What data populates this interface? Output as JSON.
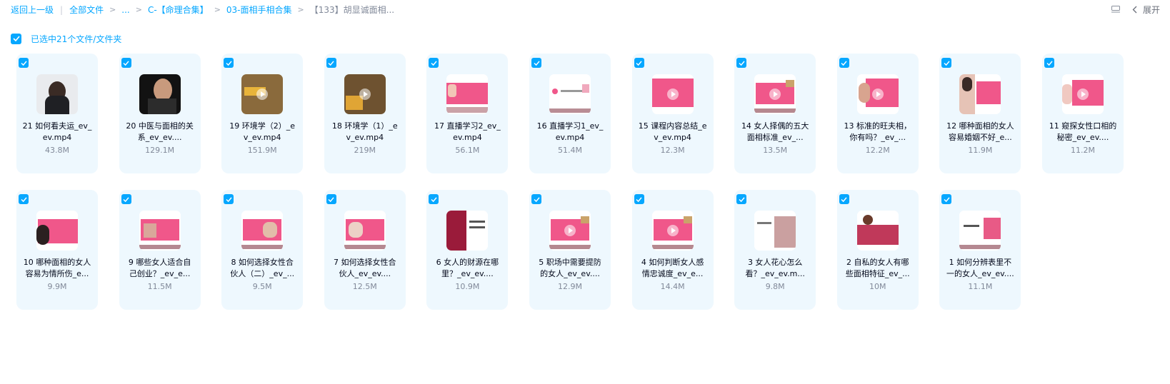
{
  "breadcrumb": {
    "back_label": "返回上一级",
    "items": [
      {
        "label": "全部文件"
      },
      {
        "label": "..."
      },
      {
        "label": "C-【命理合集】"
      },
      {
        "label": "03-面相手相合集"
      },
      {
        "label": "【133】胡显诚面相..."
      }
    ]
  },
  "toolbar": {
    "expand_label": "展开",
    "list_icon": "list-view-icon",
    "chevron_icon": "chevron-left-icon"
  },
  "selection": {
    "text": "已选中21个文件/文件夹"
  },
  "colors": {
    "accent": "#06a7ff",
    "card_bg": "#eef8fe",
    "pink": "#f0578a"
  },
  "files": [
    {
      "name": "21 如何看夫运_ev_ev.mp4",
      "size": "43.8M",
      "thumb": "person"
    },
    {
      "name": "20 中医与面相的关系_ev_ev....",
      "size": "129.1M",
      "thumb": "person-dark"
    },
    {
      "name": "19 环境学（2）_ev_ev.mp4",
      "size": "151.9M",
      "thumb": "brown"
    },
    {
      "name": "18 环境学（1）_ev_ev.mp4",
      "size": "219M",
      "thumb": "brown2"
    },
    {
      "name": "17 直播学习2_ev_ev.mp4",
      "size": "56.1M",
      "thumb": "slide-photo"
    },
    {
      "name": "16 直播学习1_ev_ev.mp4",
      "size": "51.4M",
      "thumb": "slide-white"
    },
    {
      "name": "15 课程内容总结_ev_ev.mp4",
      "size": "12.3M",
      "thumb": "slide-pink"
    },
    {
      "name": "14 女人择偶的五大面相标准_ev_...",
      "size": "13.5M",
      "thumb": "slide-pink-play"
    },
    {
      "name": "13 标准的旺夫相，你有吗？_ev_...",
      "size": "12.2M",
      "thumb": "slide-face"
    },
    {
      "name": "12 哪种面相的女人容易婚姻不好_e...",
      "size": "11.9M",
      "thumb": "slide-face2"
    },
    {
      "name": "11 窥探女性口相的秘密_ev_ev....",
      "size": "11.2M",
      "thumb": "slide-face3"
    },
    {
      "name": "10 哪种面相的女人容易为情所伤_e...",
      "size": "9.9M",
      "thumb": "slide-face4"
    },
    {
      "name": "9 哪些女人适合自己创业？_ev_e...",
      "size": "11.5M",
      "thumb": "slide-photo2"
    },
    {
      "name": "8 如何选择女性合伙人（二）_ev_...",
      "size": "9.5M",
      "thumb": "slide-photo3"
    },
    {
      "name": "7 如何选择女性合伙人_ev_ev....",
      "size": "12.5M",
      "thumb": "slide-photo4"
    },
    {
      "name": "6 女人的财源在哪里？_ev_ev....",
      "size": "10.9M",
      "thumb": "slide-red"
    },
    {
      "name": "5 职场中需要提防的女人_ev_ev....",
      "size": "12.9M",
      "thumb": "slide-pink-play"
    },
    {
      "name": "4 如何判断女人感情忠诚度_ev_e...",
      "size": "14.4M",
      "thumb": "slide-pink-play"
    },
    {
      "name": "3 女人花心怎么看？_ev_ev.m...",
      "size": "9.8M",
      "thumb": "slide-face5"
    },
    {
      "name": "2 自私的女人有哪些面相特征_ev_...",
      "size": "10M",
      "thumb": "slide-red2"
    },
    {
      "name": "1 如何分辨表里不一的女人_ev_ev....",
      "size": "11.1M",
      "thumb": "slide-flower"
    }
  ]
}
